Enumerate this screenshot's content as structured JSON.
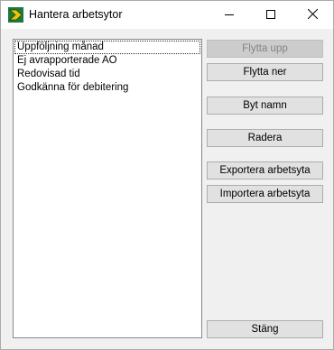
{
  "window": {
    "title": "Hantera arbetsytor"
  },
  "list": {
    "items": [
      {
        "label": "Uppföljning månad",
        "selected": true
      },
      {
        "label": "Ej avrapporterade AO",
        "selected": false
      },
      {
        "label": "Redovisad tid",
        "selected": false
      },
      {
        "label": "Godkänna för debitering",
        "selected": false
      }
    ]
  },
  "buttons": {
    "move_up": "Flytta upp",
    "move_down": "Flytta ner",
    "rename": "Byt namn",
    "delete": "Radera",
    "export": "Exportera arbetsyta",
    "import": "Importera arbetsyta",
    "close": "Stäng"
  },
  "icons": {
    "app": "app-logo-icon",
    "minimize": "minimize-icon",
    "maximize": "maximize-icon",
    "close": "close-icon"
  },
  "colors": {
    "disabled_text": "#838383",
    "button_face": "#e1e1e1"
  }
}
